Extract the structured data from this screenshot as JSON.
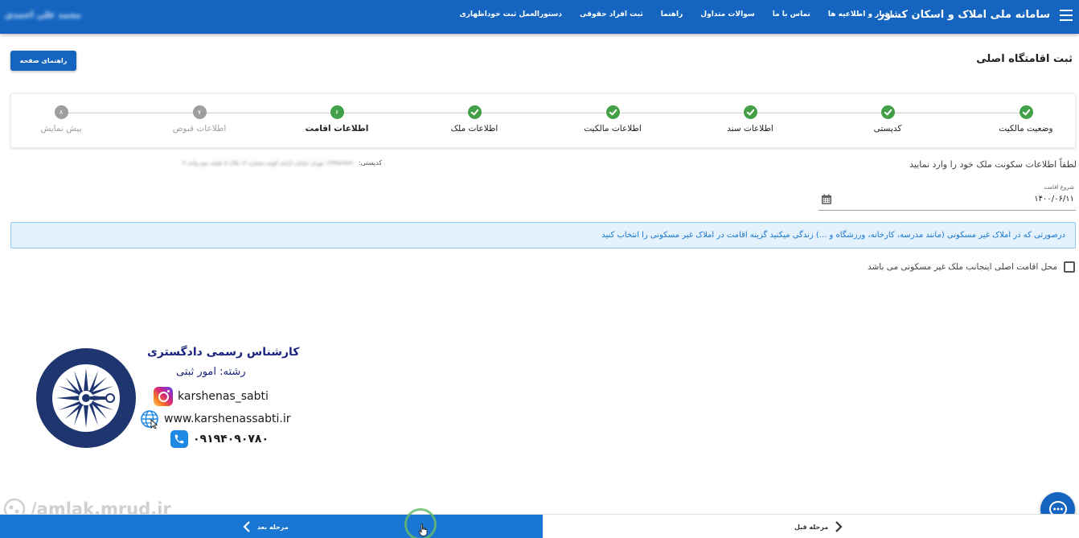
{
  "header": {
    "app_title": "سامانه ملی املاک و اسکان کشور",
    "nav": [
      "اخبار و اطلاعیه ها",
      "تماس با ما",
      "سوالات متداول",
      "راهنما",
      "ثبت افراد حقوقی",
      "دستورالعمل ثبت خوداظهاری"
    ],
    "user_name": "محمد علی احمدی"
  },
  "page": {
    "title": "ثبت اقامتگاه اصلی",
    "help_button": "راهنمای صفحه"
  },
  "stepper": {
    "steps": [
      {
        "label": "وضعیت مالکیت",
        "marker": "✓",
        "state": "done"
      },
      {
        "label": "کدپستی",
        "marker": "✓",
        "state": "done"
      },
      {
        "label": "اطلاعات سند",
        "marker": "✓",
        "state": "done"
      },
      {
        "label": "اطلاعات مالکیت",
        "marker": "✓",
        "state": "done"
      },
      {
        "label": "اطلاعات ملک",
        "marker": "✓",
        "state": "done"
      },
      {
        "label": "اطلاعات اقامت",
        "marker": "۶",
        "state": "active"
      },
      {
        "label": "اطلاعات قبوض",
        "marker": "۷",
        "state": "pending"
      },
      {
        "label": "پیش نمایش",
        "marker": "۸",
        "state": "pending"
      }
    ]
  },
  "form": {
    "instruction": "لطفاً اطلاعات سکونت ملک خود را وارد نمایید",
    "postcode_label": "کدپستی:",
    "postcode_value": "۱۲۳۴۵۶۷۸۹۰ تهران خیابان آزادی کوچه شماره ۱۲ پلاک ۵ طبقه دوم واحد ۴",
    "start_date_label": "شروع اقامت",
    "start_date_value": "۱۴۰۰/۰۶/۱۱",
    "alert_text": "درصورتی که در املاک غیر مسکونی (مانند مدرسه، کارخانه، ورزشگاه و ...) زندگی میکنید گزینه اقامت در املاک غیر مسکونی را انتخاب کنید",
    "checkbox_label": "محل اقامت اصلی اینجانب ملک غیر مسکونی می باشد"
  },
  "promo": {
    "title": "کارشناس رسمی دادگستری",
    "subtitle": "رشته: امور ثبتی",
    "instagram": "karshenas_sabti",
    "website": "www.karshenassabti.ir",
    "phone": "۰۹۱۹۴۰۹۰۷۸۰"
  },
  "watermark": "/amlak.mrud.ir",
  "footer": {
    "next_label": "مرحله بعد",
    "prev_label": "مرحله قبل"
  },
  "colors": {
    "primary": "#1565c0",
    "success": "#43a047",
    "pending": "#9e9e9e",
    "alert_bg": "#e3f2fd",
    "alert_text": "#1976d2"
  }
}
